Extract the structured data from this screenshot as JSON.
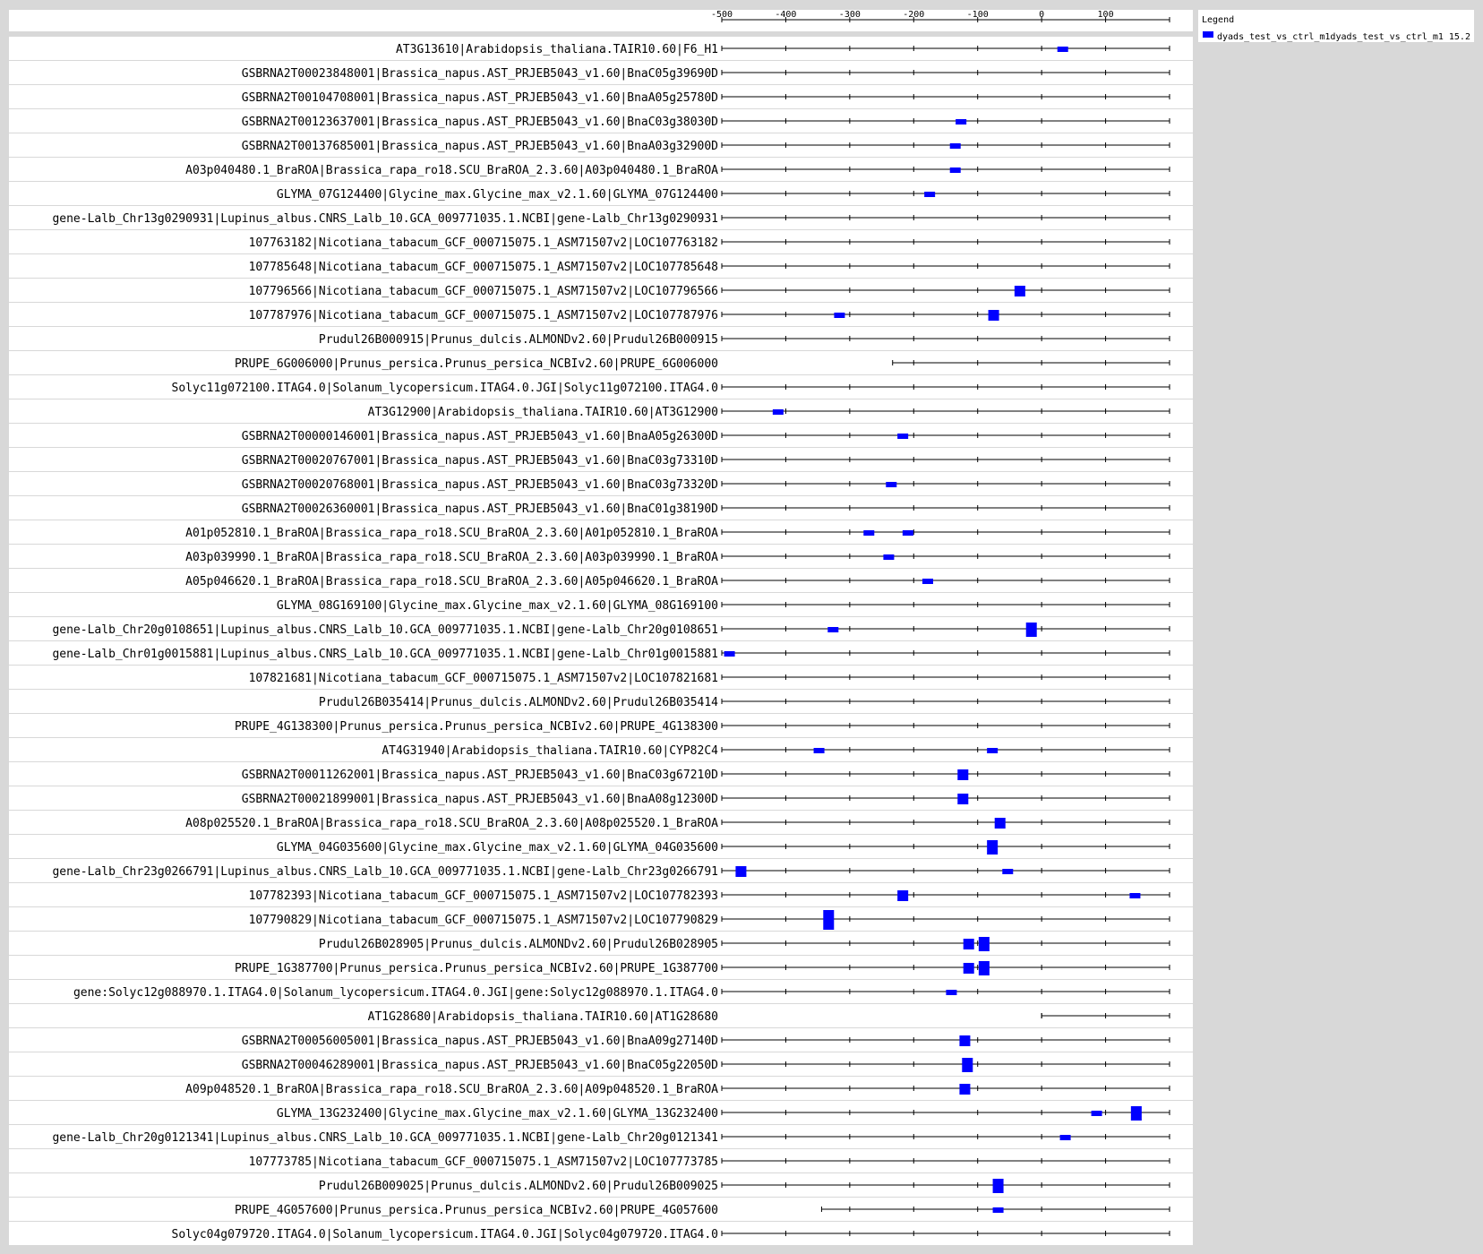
{
  "legend": {
    "title": "Legend",
    "entry_label": "dyads_test_vs_ctrl_m1dyads_test_vs_ctrl_m1 15.2",
    "color": "#0000ff"
  },
  "colors": {
    "background": "#d8d8d8",
    "panel": "#ffffff",
    "mark": "#0000ff",
    "line": "#000000"
  },
  "chart_data": {
    "type": "feature-track",
    "xlim": [
      -500,
      200
    ],
    "xticks": [
      -500,
      -400,
      -300,
      -200,
      -100,
      0,
      100
    ],
    "tick_labels": [
      "-500",
      "-400",
      "-300",
      "-200",
      "-100",
      "0",
      "100"
    ],
    "rows": [
      {
        "label": "AT3G13610|Arabidopsis_thaliana.TAIR10.60|F6_H1",
        "start": -500,
        "end": 200,
        "marks": [
          {
            "x": 33,
            "h": "s"
          }
        ]
      },
      {
        "label": "GSBRNA2T00023848001|Brassica_napus.AST_PRJEB5043_v1.60|BnaC05g39690D",
        "start": -500,
        "end": 200,
        "marks": []
      },
      {
        "label": "GSBRNA2T00104708001|Brassica_napus.AST_PRJEB5043_v1.60|BnaA05g25780D",
        "start": -500,
        "end": 200,
        "marks": []
      },
      {
        "label": "GSBRNA2T00123637001|Brassica_napus.AST_PRJEB5043_v1.60|BnaC03g38030D",
        "start": -500,
        "end": 200,
        "marks": [
          {
            "x": -126,
            "h": "s"
          }
        ]
      },
      {
        "label": "GSBRNA2T00137685001|Brassica_napus.AST_PRJEB5043_v1.60|BnaA03g32900D",
        "start": -500,
        "end": 200,
        "marks": [
          {
            "x": -135,
            "h": "s"
          }
        ]
      },
      {
        "label": "A03p040480.1_BraROA|Brassica_rapa_ro18.SCU_BraROA_2.3.60|A03p040480.1_BraROA",
        "start": -500,
        "end": 200,
        "marks": [
          {
            "x": -135,
            "h": "s"
          }
        ]
      },
      {
        "label": "GLYMA_07G124400|Glycine_max.Glycine_max_v2.1.60|GLYMA_07G124400",
        "start": -500,
        "end": 200,
        "marks": [
          {
            "x": -175,
            "h": "s"
          }
        ]
      },
      {
        "label": "gene-Lalb_Chr13g0290931|Lupinus_albus.CNRS_Lalb_10.GCA_009771035.1.NCBI|gene-Lalb_Chr13g0290931",
        "start": -500,
        "end": 200,
        "marks": []
      },
      {
        "label": "107763182|Nicotiana_tabacum_GCF_000715075.1_ASM71507v2|LOC107763182",
        "start": -500,
        "end": 200,
        "marks": []
      },
      {
        "label": "107785648|Nicotiana_tabacum_GCF_000715075.1_ASM71507v2|LOC107785648",
        "start": -500,
        "end": 200,
        "marks": []
      },
      {
        "label": "107796566|Nicotiana_tabacum_GCF_000715075.1_ASM71507v2|LOC107796566",
        "start": -500,
        "end": 200,
        "marks": [
          {
            "x": -34,
            "h": "m"
          }
        ]
      },
      {
        "label": "107787976|Nicotiana_tabacum_GCF_000715075.1_ASM71507v2|LOC107787976",
        "start": -500,
        "end": 200,
        "marks": [
          {
            "x": -316,
            "h": "s"
          },
          {
            "x": -75,
            "h": "m"
          }
        ]
      },
      {
        "label": "Prudul26B000915|Prunus_dulcis.ALMONDv2.60|Prudul26B000915",
        "start": -500,
        "end": 200,
        "marks": []
      },
      {
        "label": "PRUPE_6G006000|Prunus_persica.Prunus_persica_NCBIv2.60|PRUPE_6G006000",
        "start": -233,
        "end": 200,
        "marks": []
      },
      {
        "label": "Solyc11g072100.ITAG4.0|Solanum_lycopersicum.ITAG4.0.JGI|Solyc11g072100.ITAG4.0",
        "start": -500,
        "end": 200,
        "marks": []
      },
      {
        "label": "AT3G12900|Arabidopsis_thaliana.TAIR10.60|AT3G12900",
        "start": -500,
        "end": 200,
        "marks": [
          {
            "x": -412,
            "h": "s"
          }
        ]
      },
      {
        "label": "GSBRNA2T00000146001|Brassica_napus.AST_PRJEB5043_v1.60|BnaA05g26300D",
        "start": -500,
        "end": 200,
        "marks": [
          {
            "x": -217,
            "h": "s"
          }
        ]
      },
      {
        "label": "GSBRNA2T00020767001|Brassica_napus.AST_PRJEB5043_v1.60|BnaC03g73310D",
        "start": -500,
        "end": 200,
        "marks": []
      },
      {
        "label": "GSBRNA2T00020768001|Brassica_napus.AST_PRJEB5043_v1.60|BnaC03g73320D",
        "start": -500,
        "end": 200,
        "marks": [
          {
            "x": -235,
            "h": "s"
          }
        ]
      },
      {
        "label": "GSBRNA2T00026360001|Brassica_napus.AST_PRJEB5043_v1.60|BnaC01g38190D",
        "start": -500,
        "end": 200,
        "marks": []
      },
      {
        "label": "A01p052810.1_BraROA|Brassica_rapa_ro18.SCU_BraROA_2.3.60|A01p052810.1_BraROA",
        "start": -500,
        "end": 200,
        "marks": [
          {
            "x": -270,
            "h": "s"
          },
          {
            "x": -209,
            "h": "s"
          }
        ]
      },
      {
        "label": "A03p039990.1_BraROA|Brassica_rapa_ro18.SCU_BraROA_2.3.60|A03p039990.1_BraROA",
        "start": -500,
        "end": 200,
        "marks": [
          {
            "x": -239,
            "h": "s"
          }
        ]
      },
      {
        "label": "A05p046620.1_BraROA|Brassica_rapa_ro18.SCU_BraROA_2.3.60|A05p046620.1_BraROA",
        "start": -500,
        "end": 200,
        "marks": [
          {
            "x": -178,
            "h": "s"
          }
        ]
      },
      {
        "label": "GLYMA_08G169100|Glycine_max.Glycine_max_v2.1.60|GLYMA_08G169100",
        "start": -500,
        "end": 200,
        "marks": []
      },
      {
        "label": "gene-Lalb_Chr20g0108651|Lupinus_albus.CNRS_Lalb_10.GCA_009771035.1.NCBI|gene-Lalb_Chr20g0108651",
        "start": -500,
        "end": 200,
        "marks": [
          {
            "x": -326,
            "h": "s"
          },
          {
            "x": -16,
            "h": "l"
          }
        ]
      },
      {
        "label": "gene-Lalb_Chr01g0015881|Lupinus_albus.CNRS_Lalb_10.GCA_009771035.1.NCBI|gene-Lalb_Chr01g0015881",
        "start": -500,
        "end": 200,
        "marks": [
          {
            "x": -488,
            "h": "s"
          }
        ]
      },
      {
        "label": "107821681|Nicotiana_tabacum_GCF_000715075.1_ASM71507v2|LOC107821681",
        "start": -500,
        "end": 200,
        "marks": []
      },
      {
        "label": "Prudul26B035414|Prunus_dulcis.ALMONDv2.60|Prudul26B035414",
        "start": -500,
        "end": 200,
        "marks": []
      },
      {
        "label": "PRUPE_4G138300|Prunus_persica.Prunus_persica_NCBIv2.60|PRUPE_4G138300",
        "start": -500,
        "end": 200,
        "marks": []
      },
      {
        "label": "AT4G31940|Arabidopsis_thaliana.TAIR10.60|CYP82C4",
        "start": -500,
        "end": 200,
        "marks": [
          {
            "x": -348,
            "h": "s"
          },
          {
            "x": -77,
            "h": "s"
          }
        ]
      },
      {
        "label": "GSBRNA2T00011262001|Brassica_napus.AST_PRJEB5043_v1.60|BnaC03g67210D",
        "start": -500,
        "end": 200,
        "marks": [
          {
            "x": -123,
            "h": "m"
          }
        ]
      },
      {
        "label": "GSBRNA2T00021899001|Brassica_napus.AST_PRJEB5043_v1.60|BnaA08g12300D",
        "start": -500,
        "end": 200,
        "marks": [
          {
            "x": -123,
            "h": "m"
          }
        ]
      },
      {
        "label": "A08p025520.1_BraROA|Brassica_rapa_ro18.SCU_BraROA_2.3.60|A08p025520.1_BraROA",
        "start": -500,
        "end": 200,
        "marks": [
          {
            "x": -65,
            "h": "m"
          }
        ]
      },
      {
        "label": "GLYMA_04G035600|Glycine_max.Glycine_max_v2.1.60|GLYMA_04G035600",
        "start": -500,
        "end": 200,
        "marks": [
          {
            "x": -77,
            "h": "l"
          }
        ]
      },
      {
        "label": "gene-Lalb_Chr23g0266791|Lupinus_albus.CNRS_Lalb_10.GCA_009771035.1.NCBI|gene-Lalb_Chr23g0266791",
        "start": -500,
        "end": 200,
        "marks": [
          {
            "x": -470,
            "h": "m"
          },
          {
            "x": -53,
            "h": "s"
          }
        ]
      },
      {
        "label": "107782393|Nicotiana_tabacum_GCF_000715075.1_ASM71507v2|LOC107782393",
        "start": -500,
        "end": 200,
        "marks": [
          {
            "x": -217,
            "h": "m"
          },
          {
            "x": 146,
            "h": "s"
          }
        ]
      },
      {
        "label": "107790829|Nicotiana_tabacum_GCF_000715075.1_ASM71507v2|LOC107790829",
        "start": -500,
        "end": 200,
        "marks": [
          {
            "x": -333,
            "h": "x"
          }
        ]
      },
      {
        "label": "Prudul26B028905|Prunus_dulcis.ALMONDv2.60|Prudul26B028905",
        "start": -500,
        "end": 200,
        "marks": [
          {
            "x": -114,
            "h": "m"
          },
          {
            "x": -90,
            "h": "l"
          }
        ]
      },
      {
        "label": "PRUPE_1G387700|Prunus_persica.Prunus_persica_NCBIv2.60|PRUPE_1G387700",
        "start": -500,
        "end": 200,
        "marks": [
          {
            "x": -114,
            "h": "m"
          },
          {
            "x": -90,
            "h": "l"
          }
        ]
      },
      {
        "label": "gene:Solyc12g088970.1.ITAG4.0|Solanum_lycopersicum.ITAG4.0.JGI|gene:Solyc12g088970.1.ITAG4.0",
        "start": -500,
        "end": 200,
        "marks": [
          {
            "x": -141,
            "h": "s"
          }
        ]
      },
      {
        "label": "AT1G28680|Arabidopsis_thaliana.TAIR10.60|AT1G28680",
        "start": 0,
        "end": 200,
        "marks": []
      },
      {
        "label": "GSBRNA2T00056005001|Brassica_napus.AST_PRJEB5043_v1.60|BnaA09g27140D",
        "start": -500,
        "end": 200,
        "marks": [
          {
            "x": -120,
            "h": "m"
          }
        ]
      },
      {
        "label": "GSBRNA2T00046289001|Brassica_napus.AST_PRJEB5043_v1.60|BnaC05g22050D",
        "start": -500,
        "end": 200,
        "marks": [
          {
            "x": -116,
            "h": "l"
          }
        ]
      },
      {
        "label": "A09p048520.1_BraROA|Brassica_rapa_ro18.SCU_BraROA_2.3.60|A09p048520.1_BraROA",
        "start": -500,
        "end": 200,
        "marks": [
          {
            "x": -120,
            "h": "m"
          }
        ]
      },
      {
        "label": "GLYMA_13G232400|Glycine_max.Glycine_max_v2.1.60|GLYMA_13G232400",
        "start": -500,
        "end": 200,
        "marks": [
          {
            "x": 86,
            "h": "s"
          },
          {
            "x": 148,
            "h": "l"
          }
        ]
      },
      {
        "label": "gene-Lalb_Chr20g0121341|Lupinus_albus.CNRS_Lalb_10.GCA_009771035.1.NCBI|gene-Lalb_Chr20g0121341",
        "start": -500,
        "end": 200,
        "marks": [
          {
            "x": 37,
            "h": "s"
          }
        ]
      },
      {
        "label": "107773785|Nicotiana_tabacum_GCF_000715075.1_ASM71507v2|LOC107773785",
        "start": -500,
        "end": 200,
        "marks": []
      },
      {
        "label": "Prudul26B009025|Prunus_dulcis.ALMONDv2.60|Prudul26B009025",
        "start": -500,
        "end": 200,
        "marks": [
          {
            "x": -68,
            "h": "l"
          }
        ]
      },
      {
        "label": "PRUPE_4G057600|Prunus_persica.Prunus_persica_NCBIv2.60|PRUPE_4G057600",
        "start": -344,
        "end": 200,
        "marks": [
          {
            "x": -68,
            "h": "s"
          }
        ]
      },
      {
        "label": "Solyc04g079720.ITAG4.0|Solanum_lycopersicum.ITAG4.0.JGI|Solyc04g079720.ITAG4.0",
        "start": -500,
        "end": 200,
        "marks": []
      }
    ]
  }
}
